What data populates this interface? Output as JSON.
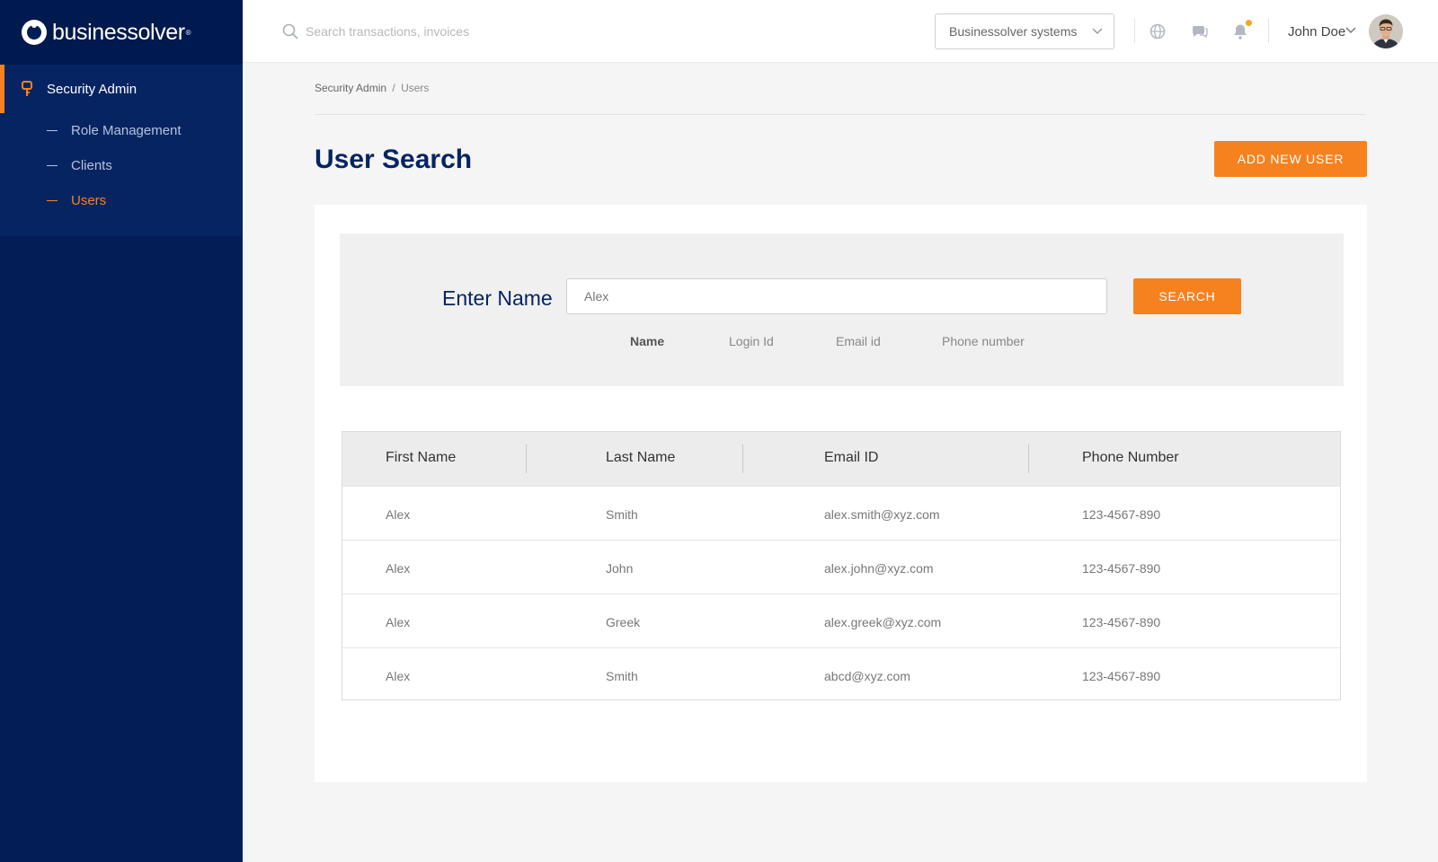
{
  "brand": {
    "name": "businessolver",
    "tm": "®"
  },
  "sidebar": {
    "section_label": "Security Admin",
    "items": [
      {
        "label": "Role Management",
        "active": false
      },
      {
        "label": "Clients",
        "active": false
      },
      {
        "label": "Users",
        "active": true
      }
    ]
  },
  "topbar": {
    "search_placeholder": "Search transactions, invoices",
    "org_select_value": "Businessolver systems",
    "user_name": "John Doe",
    "icons": [
      "globe-icon",
      "chat-icon",
      "bell-icon"
    ]
  },
  "breadcrumb": {
    "parent": "Security Admin",
    "separator": "/",
    "current": "Users"
  },
  "page": {
    "title": "User Search",
    "add_button_label": "ADD NEW USER"
  },
  "search_panel": {
    "label": "Enter Name",
    "input_value": "Alex",
    "button_label": "SEARCH",
    "filters": [
      {
        "label": "Name",
        "active": true
      },
      {
        "label": "Login Id",
        "active": false
      },
      {
        "label": "Email id",
        "active": false
      },
      {
        "label": "Phone number",
        "active": false
      }
    ]
  },
  "results": {
    "columns": [
      "First Name",
      "Last Name",
      "Email ID",
      "Phone Number"
    ],
    "rows": [
      [
        "Alex",
        "Smith",
        "alex.smith@xyz.com",
        "123-4567-890"
      ],
      [
        "Alex",
        "John",
        "alex.john@xyz.com",
        "123-4567-890"
      ],
      [
        "Alex",
        "Greek",
        "alex.greek@xyz.com",
        "123-4567-890"
      ],
      [
        "Alex",
        "Smith",
        "abcd@xyz.com",
        "123-4567-890"
      ]
    ]
  },
  "colors": {
    "navy": "#031d57",
    "accent": "#f6821f",
    "title": "#052462",
    "notification": "#f6a623"
  }
}
